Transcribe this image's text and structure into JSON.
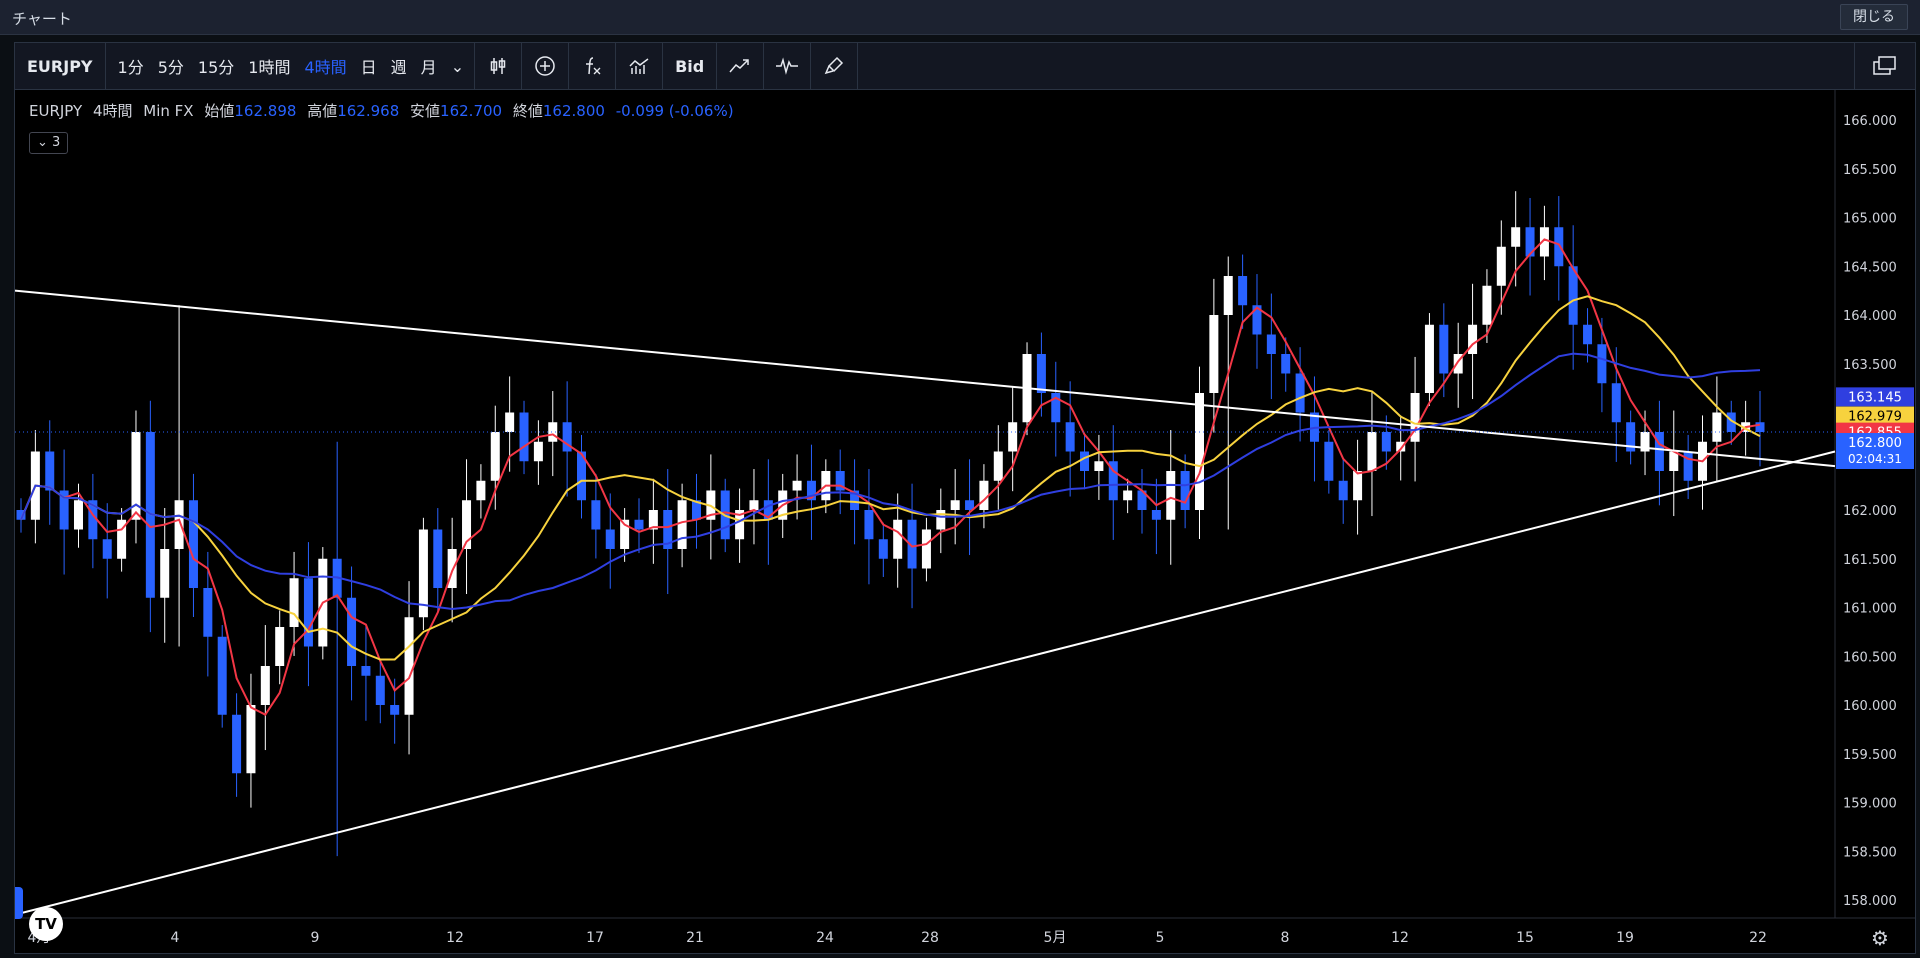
{
  "window": {
    "title": "チャート",
    "close_label": "閉じる"
  },
  "toolbar": {
    "symbol": "EURJPY",
    "timeframes": [
      "1分",
      "5分",
      "15分",
      "1時間",
      "4時間",
      "日",
      "週",
      "月"
    ],
    "active_timeframe": "4時間",
    "dropdown_glyph": "⌄",
    "bid_label": "Bid",
    "icons": [
      "candles-icon",
      "add-compare-icon",
      "indicators-icon",
      "chart-type-icon",
      "trend-icon",
      "oscillator-icon",
      "brush-icon"
    ],
    "layout_icon": "windows-icon"
  },
  "legend": {
    "symbol": "EURJPY",
    "interval": "4時間",
    "source": "Min FX",
    "open_label": "始値",
    "open": "162.898",
    "high_label": "高値",
    "high": "162.968",
    "low_label": "安値",
    "low": "162.700",
    "close_label": "終値",
    "close": "162.800",
    "change": "-0.099 (-0.06%)",
    "indicator_badge": "⌄ 3"
  },
  "colors": {
    "up_candle": "#ffffff",
    "down_candle": "#2962ff",
    "ma_fast": "#f23645",
    "ma_mid": "#f7d23e",
    "ma_slow": "#2f3fe0",
    "trendline": "#ffffff",
    "background": "#000000",
    "text": "#d1d4dc"
  },
  "chart_data": {
    "type": "candlestick",
    "title": "",
    "xlabel": "",
    "ylabel": "",
    "ylim": [
      157.75,
      166.1
    ],
    "y_ticks": [
      "158.000",
      "158.500",
      "159.000",
      "159.500",
      "160.000",
      "160.500",
      "161.000",
      "161.500",
      "162.000",
      "162.500",
      "163.000",
      "163.500",
      "164.000",
      "164.500",
      "165.000",
      "165.500",
      "166.000"
    ],
    "x_ticks": [
      "4月",
      "4",
      "9",
      "12",
      "17",
      "21",
      "24",
      "28",
      "5月",
      "5",
      "8",
      "12",
      "15",
      "19",
      "22"
    ],
    "price_labels": [
      {
        "series": "ma_slow",
        "value": "163.145",
        "bg": "#2f3fe0",
        "fg": "#ffffff"
      },
      {
        "series": "ma_mid",
        "value": "162.979",
        "bg": "#f7d23e",
        "fg": "#000000"
      },
      {
        "series": "ma_fast",
        "value": "162.855",
        "bg": "#f23645",
        "fg": "#ffffff"
      },
      {
        "series": "last",
        "value": "162.800",
        "countdown": "02:04:31",
        "bg": "#2962ff",
        "fg": "#ffffff"
      }
    ],
    "close_series": [
      161.9,
      162.6,
      162.2,
      161.8,
      162.1,
      161.7,
      161.5,
      161.9,
      162.8,
      161.1,
      161.6,
      162.1,
      161.2,
      160.7,
      159.9,
      159.3,
      160.0,
      160.4,
      160.8,
      161.3,
      160.6,
      161.5,
      161.1,
      160.4,
      160.3,
      160.0,
      159.9,
      160.9,
      161.8,
      161.2,
      161.6,
      162.1,
      162.3,
      162.8,
      163.0,
      162.5,
      162.7,
      162.9,
      162.6,
      162.1,
      161.8,
      161.6,
      161.9,
      161.8,
      162.0,
      161.6,
      162.1,
      161.9,
      162.2,
      161.7,
      162.0,
      162.1,
      161.9,
      162.2,
      162.3,
      162.1,
      162.4,
      162.2,
      162.0,
      161.7,
      161.5,
      161.9,
      161.4,
      161.8,
      162.0,
      162.1,
      162.0,
      162.3,
      162.6,
      162.9,
      163.6,
      163.2,
      162.9,
      162.6,
      162.4,
      162.5,
      162.1,
      162.2,
      162.0,
      161.9,
      162.4,
      162.0,
      163.2,
      164.0,
      164.4,
      164.1,
      163.8,
      163.6,
      163.4,
      163.0,
      162.7,
      162.3,
      162.1,
      162.4,
      162.8,
      162.6,
      162.7,
      163.2,
      163.9,
      163.4,
      163.6,
      163.9,
      164.3,
      164.7,
      164.9,
      164.6,
      164.9,
      164.5,
      163.9,
      163.7,
      163.3,
      162.9,
      162.6,
      162.8,
      162.4,
      162.6,
      162.3,
      162.7,
      163.0,
      162.8,
      162.9,
      162.8
    ],
    "ranges": [
      {
        "x": "4月",
        "high": 164.1,
        "low": 160.6
      },
      {
        "x": "6",
        "high": 162.7,
        "low": 158.45
      },
      {
        "x": "5月3",
        "high": 164.6,
        "low": 161.8
      },
      {
        "x": "14",
        "high": 165.2,
        "low": 164.2
      }
    ],
    "trendlines": [
      {
        "name": "upper",
        "from": [
          "4月",
          164.25
        ],
        "to": [
          "22",
          162.45
        ]
      },
      {
        "name": "lower",
        "from": [
          "4月",
          157.85
        ],
        "to": [
          "22+",
          162.6
        ]
      }
    ]
  }
}
